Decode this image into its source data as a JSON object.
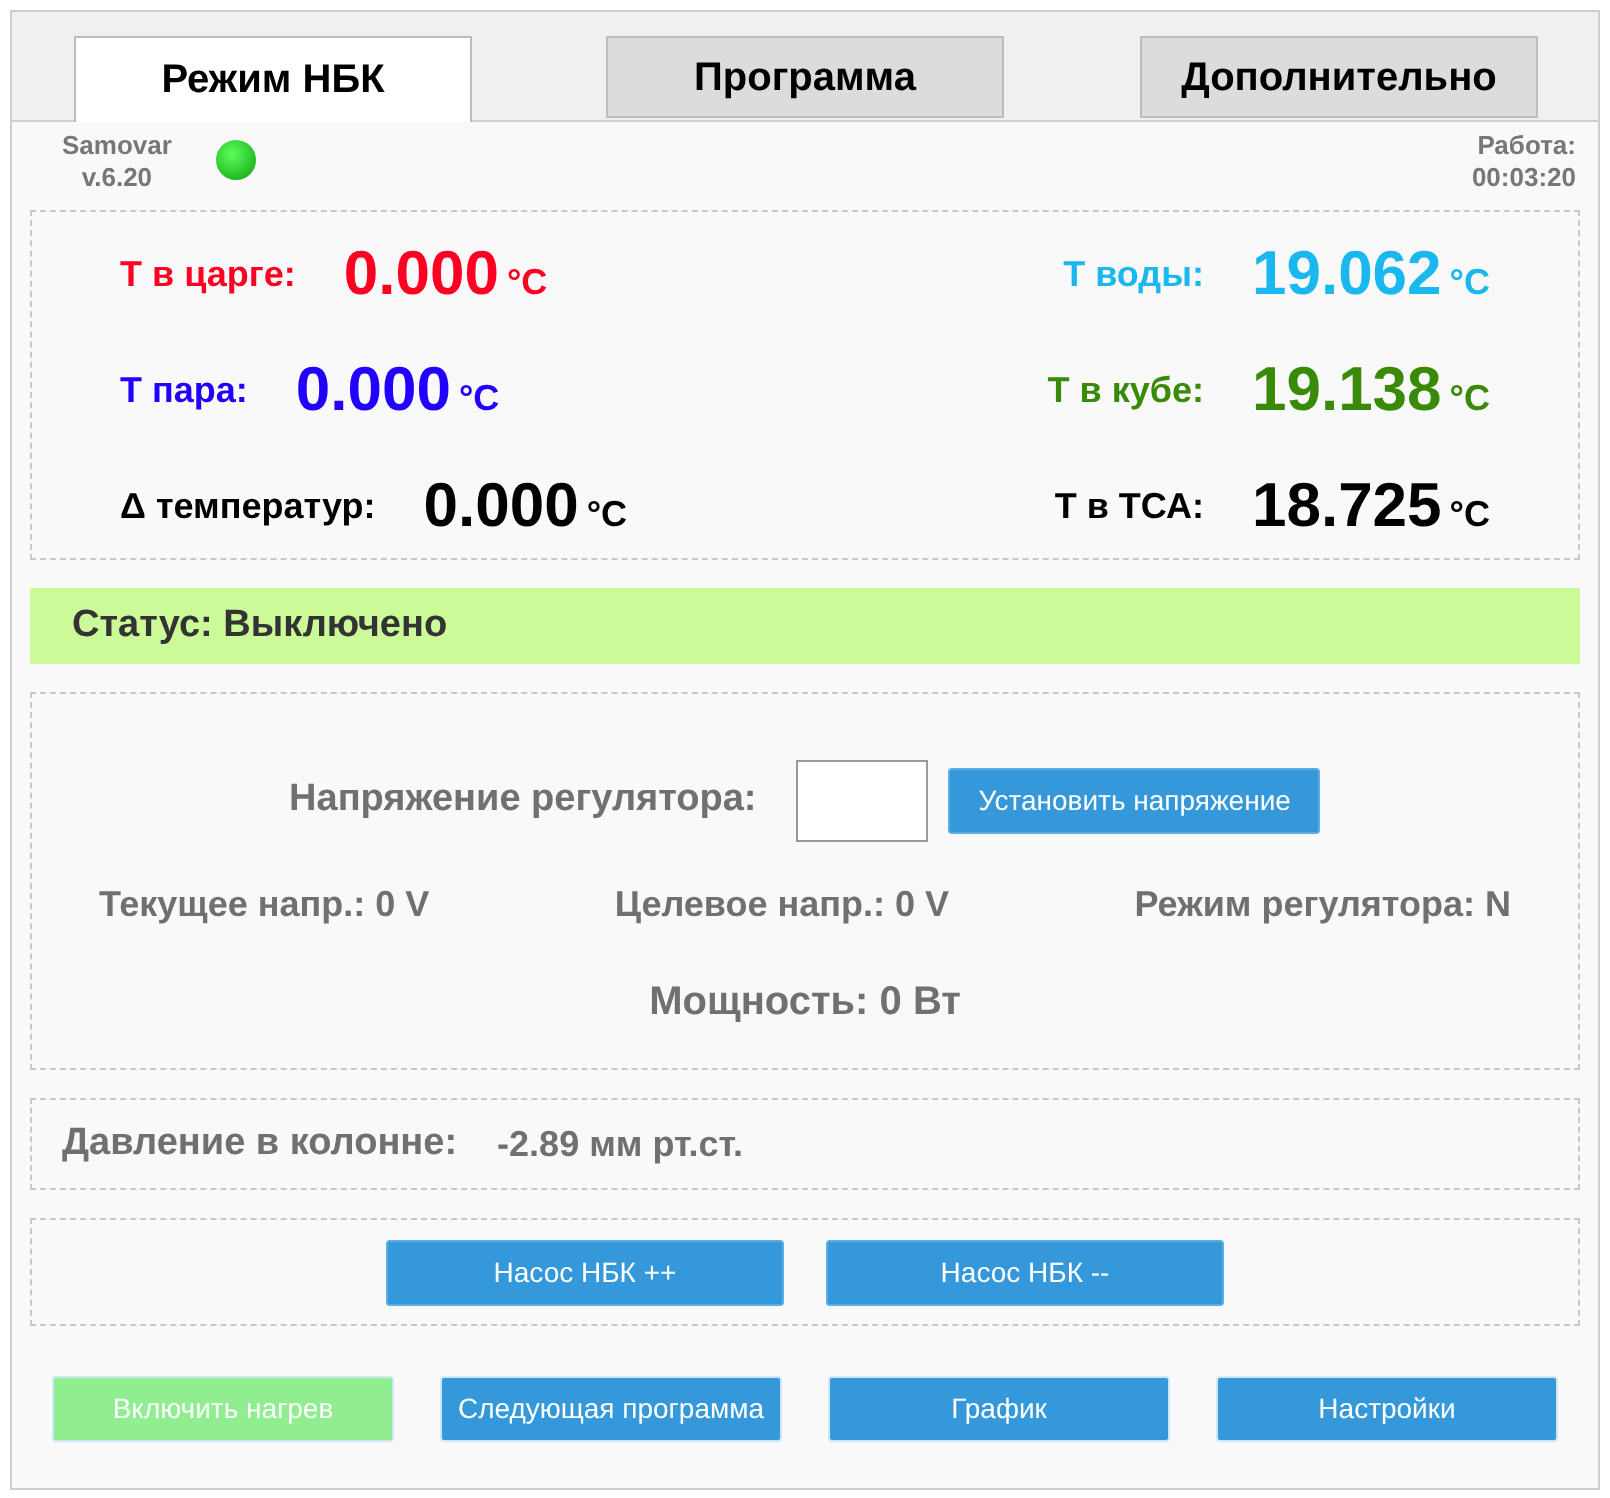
{
  "tabs": [
    {
      "label": "Режим НБК",
      "selected": true
    },
    {
      "label": "Программа",
      "selected": false
    },
    {
      "label": "Дополнительно",
      "selected": false
    }
  ],
  "header": {
    "app_name": "Samovar",
    "version": "v.6.20",
    "connected": true,
    "uptime_label": "Работа:",
    "uptime": "00:03:20"
  },
  "temperatures": {
    "left": [
      {
        "label": "Т в царге:",
        "value": "0.000",
        "unit": "°C",
        "color": "#ff0022"
      },
      {
        "label": "Т пара:",
        "value": "0.000",
        "unit": "°C",
        "color": "#2200ff"
      },
      {
        "label": "Δ температур:",
        "value": "0.000",
        "unit": "°C",
        "color": "#000000"
      }
    ],
    "right": [
      {
        "label": "Т воды:",
        "value": "19.062",
        "unit": "°C",
        "color": "#1ab8ee"
      },
      {
        "label": "Т в кубе:",
        "value": "19.138",
        "unit": "°C",
        "color": "#3a8a0a"
      },
      {
        "label": "Т в ТСА:",
        "value": "18.725",
        "unit": "°C",
        "color": "#000000"
      }
    ]
  },
  "status": "Статус: Выключено",
  "regulator": {
    "label": "Напряжение регулятора:",
    "button": "Установить напряжение",
    "readings": [
      "Текущее напр.: 0 V",
      "Целевое напр.: 0 V",
      "Режим регулятора: N"
    ],
    "power": "Мощность: 0 Вт"
  },
  "pressure": {
    "label": "Давление в колонне:",
    "value": "-2.89 мм рт.ст."
  },
  "pump_buttons": [
    "Насос НБК ++",
    "Насос НБК --"
  ],
  "bottom_buttons": [
    {
      "label": "Включить нагрев",
      "color": "#90ee90"
    },
    {
      "label": "Следующая программа",
      "color": "#3498db"
    },
    {
      "label": "График",
      "color": "#3498db"
    },
    {
      "label": "Настройки",
      "color": "#3498db"
    }
  ]
}
